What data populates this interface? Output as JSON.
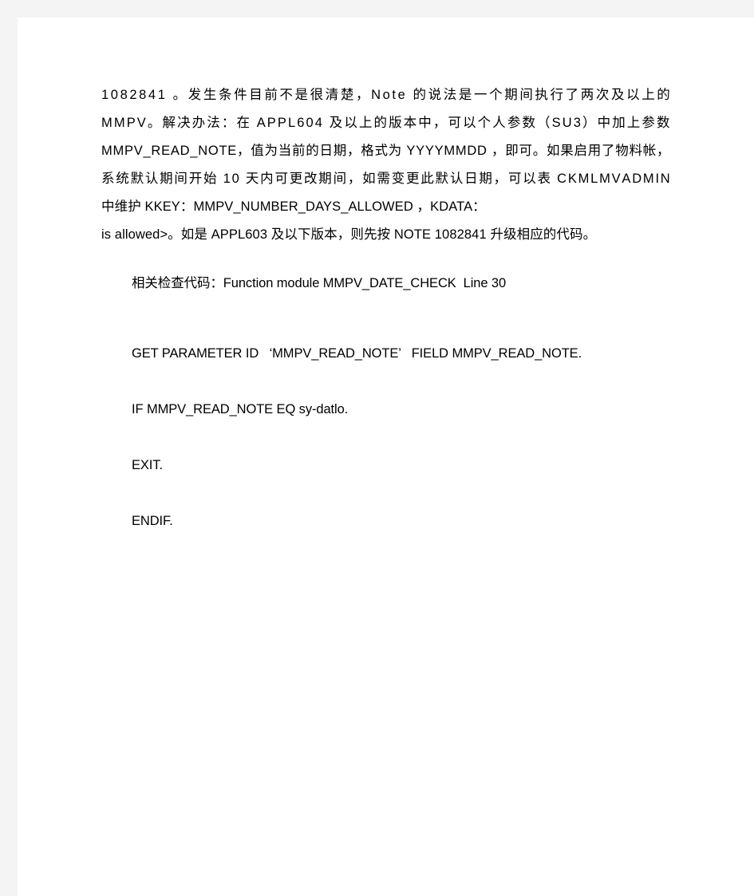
{
  "document": {
    "background_color": "#f4f4f4",
    "page_color": "#ffffff",
    "text_color": "#000000",
    "paragraph_lines": [
      "1082841 。发生条件目前不是很清楚，Note 的说法是一个期间执行了两次及以上的",
      "MMPV。解决办法：在 APPL604 及以上的版本中，可以个人参数（SU3）中加上参数",
      "MMPV_READ_NOTE，值为当前的日期，格式为 YYYYMMDD ，即可。如果启用了物料帐，",
      "系统默认期间开始 10 天内可更改期间，如需变更此默认日期，可以表 CKMLMVADMIN",
      "中维护 KKEY：MMPV_NUMBER_DAYS_ALLOWED  ，KDATA：",
      "is allowed>。如是 APPL603 及以下版本，则先按 NOTE 1082841 升级相应的代码。"
    ],
    "code_lines": [
      "相关检查代码：Function module MMPV_DATE_CHECK  Line 30",
      "GET PARAMETER ID   ‘MMPV_READ_NOTE’   FIELD MMPV_READ_NOTE.",
      "IF MMPV_READ_NOTE EQ sy-datlo.",
      "EXIT.",
      "ENDIF."
    ]
  }
}
